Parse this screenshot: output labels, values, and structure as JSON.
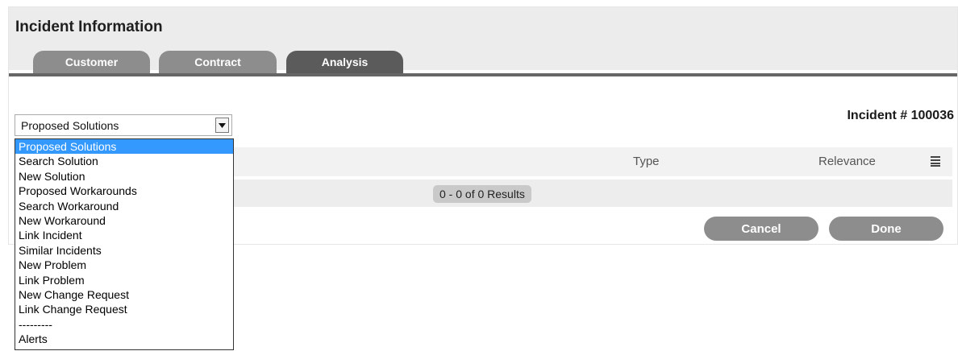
{
  "panel": {
    "title": "Incident Information"
  },
  "tabs": [
    {
      "label": "Customer",
      "active": false
    },
    {
      "label": "Contract",
      "active": false
    },
    {
      "label": "Analysis",
      "active": true
    }
  ],
  "incident": {
    "number_label": "Incident # 100036"
  },
  "analysis_select": {
    "selected_value": "Proposed Solutions",
    "options": [
      "Proposed Solutions",
      "Search Solution",
      "New Solution",
      "Proposed Workarounds",
      "Search Workaround",
      "New Workaround",
      "Link Incident",
      "Similar Incidents",
      "New Problem",
      "Link Problem",
      "New Change Request",
      "Link Change Request",
      "---------",
      "Alerts"
    ],
    "highlighted_index": 0
  },
  "grid": {
    "columns": [
      "Type",
      "Relevance"
    ],
    "column_menu_icon": "column-menu-icon",
    "results_text": "0 - 0 of 0 Results"
  },
  "actions": {
    "cancel_label": "Cancel",
    "done_label": "Done"
  },
  "colors": {
    "tab_inactive": "#8d8d8d",
    "tab_active": "#5b5b5b",
    "button": "#8d8d8d",
    "dropdown_highlight": "#3399ff"
  }
}
